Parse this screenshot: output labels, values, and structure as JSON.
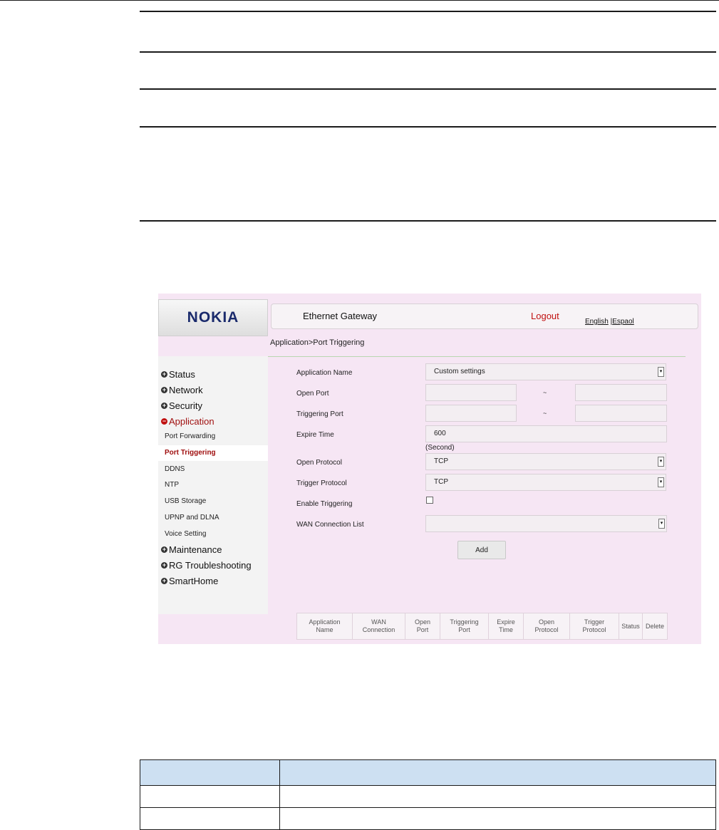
{
  "device": {
    "logo": "NOKIA",
    "title": "Ethernet Gateway",
    "logout": "Logout",
    "lang_english": "English",
    "lang_separator": " |",
    "lang_other": "Espaol",
    "breadcrumb": "Application>Port Triggering"
  },
  "sidebar": {
    "top_items": [
      {
        "label": "Status",
        "icon": "plus-icon"
      },
      {
        "label": "Network",
        "icon": "plus-icon"
      },
      {
        "label": "Security",
        "icon": "plus-icon"
      },
      {
        "label": "Application",
        "icon": "minus-icon"
      },
      {
        "label": "Maintenance",
        "icon": "plus-icon"
      },
      {
        "label": "RG Troubleshooting",
        "icon": "plus-icon"
      },
      {
        "label": "SmartHome",
        "icon": "plus-icon"
      }
    ],
    "sub_items": [
      "Port Forwarding",
      "Port Triggering",
      "DDNS",
      "NTP",
      "USB Storage",
      "UPNP and DLNA",
      "Voice Setting"
    ],
    "active_sub": "Port Triggering"
  },
  "form": {
    "application_name_label": "Application Name",
    "application_name_value": "Custom settings",
    "open_port_label": "Open Port",
    "triggering_port_label": "Triggering Port",
    "range_separator": "~",
    "expire_time_label": "Expire Time",
    "expire_time_value": "600",
    "expire_time_unit": "(Second)",
    "open_protocol_label": "Open Protocol",
    "open_protocol_value": "TCP",
    "trigger_protocol_label": "Trigger Protocol",
    "trigger_protocol_value": "TCP",
    "enable_triggering_label": "Enable Triggering",
    "enable_triggering_checked": false,
    "wan_connection_label": "WAN Connection List",
    "wan_connection_value": "",
    "add_button": "Add"
  },
  "rules_table": {
    "columns": [
      [
        "Application",
        "Name"
      ],
      [
        "WAN",
        "Connection"
      ],
      [
        "Open",
        "Port"
      ],
      [
        "Triggering",
        "Port"
      ],
      [
        "Expire",
        "Time"
      ],
      [
        "Open",
        "Protocol"
      ],
      [
        "Trigger",
        "Protocol"
      ],
      [
        "Status",
        ""
      ],
      [
        "Delete",
        ""
      ]
    ]
  },
  "colors": {
    "accent_red": "#c01010",
    "frame_background": "#f6e6f4",
    "doc_table_header": "#cde0f2"
  }
}
